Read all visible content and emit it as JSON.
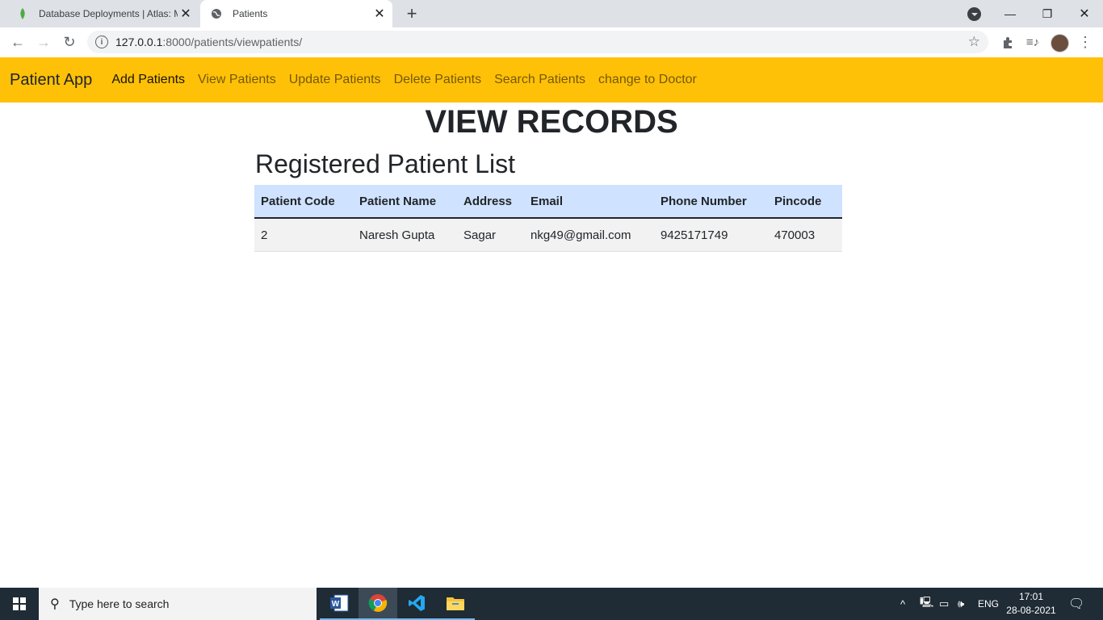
{
  "browser": {
    "tabs": [
      {
        "title": "Database Deployments | Atlas: M",
        "icon": "mongodb-leaf-icon"
      },
      {
        "title": "Patients",
        "icon": "globe-icon"
      }
    ],
    "url_host": "127.0.0.1",
    "url_rest": ":8000/patients/viewpatients/"
  },
  "navbar": {
    "brand": "Patient App",
    "links": [
      "Add Patients",
      "View Patients",
      "Update Patients",
      "Delete Patients",
      "Search Patients",
      "change to Doctor"
    ],
    "color": "#ffc107"
  },
  "page": {
    "heading": "VIEW RECORDS",
    "subheading": "Registered Patient List"
  },
  "table": {
    "headers": [
      "Patient Code",
      "Patient Name",
      "Address",
      "Email",
      "Phone Number",
      "Pincode"
    ],
    "rows": [
      [
        "2",
        "Naresh Gupta",
        "Sagar",
        "nkg49@gmail.com",
        "9425171749",
        "470003"
      ]
    ],
    "header_color": "#cfe2ff"
  },
  "taskbar": {
    "search_placeholder": "Type here to search",
    "language": "ENG",
    "time": "17:01",
    "date": "28-08-2021"
  }
}
